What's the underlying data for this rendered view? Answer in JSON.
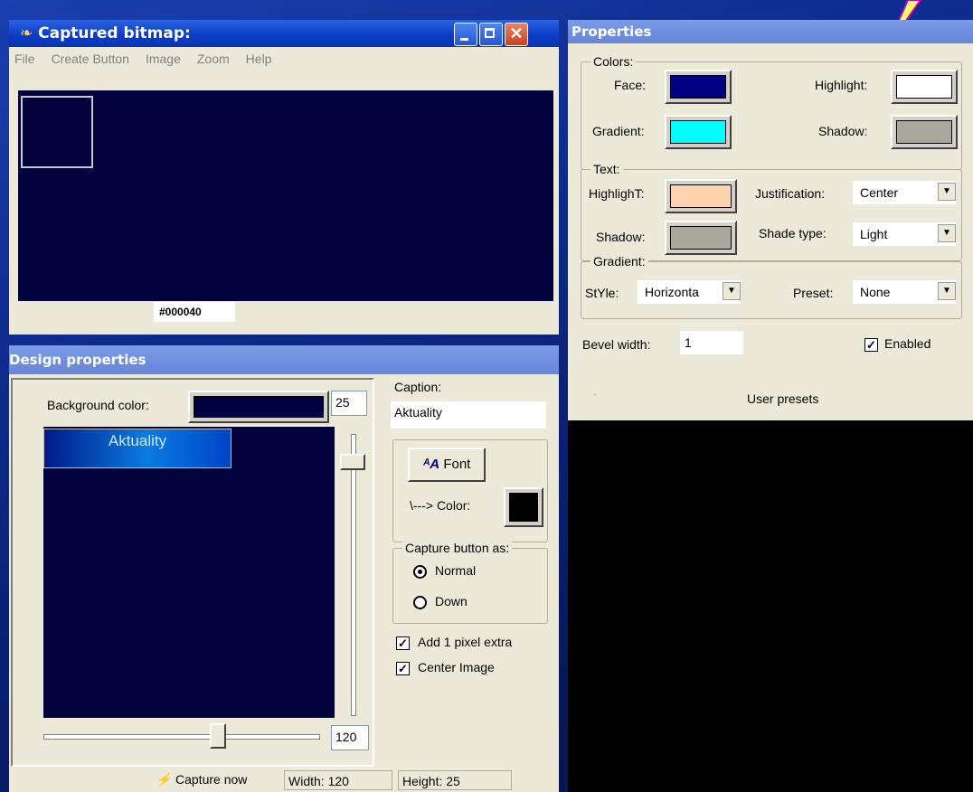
{
  "captured_window": {
    "title": "Captured bitmap:",
    "menu": [
      "File",
      "Create Button",
      "Image",
      "Zoom",
      "Help"
    ],
    "color_value": "#000040"
  },
  "properties_panel": {
    "title": "Properties",
    "colors": {
      "legend": "Colors:",
      "face_label": "Face:",
      "highlight_label": "Highlight:",
      "gradient_label": "Gradient:",
      "shadow_label": "Shadow:",
      "face_color": "#000080",
      "highlight_color": "#ffffff",
      "gradient_color": "#00ffff",
      "shadow_color": "#a8a89c"
    },
    "text": {
      "legend": "Text:",
      "highlight_label": "HighlighT:",
      "shadow_label": "Shadow:",
      "justification_label": "Justification:",
      "justification_value": "Center",
      "shade_type_label": "Shade type:",
      "shade_type_value": "Light",
      "highlight_color": "#ffd2b0",
      "shadow_color": "#a8a89c"
    },
    "gradient": {
      "legend": "Gradient:",
      "style_label": "StYle:",
      "style_value": "Horizonta",
      "preset_label": "Preset:",
      "preset_value": "None"
    },
    "bevel_label": "Bevel width:",
    "bevel_value": "1",
    "enabled_label": "Enabled",
    "enabled_checked": true,
    "user_presets": "User presets"
  },
  "design_window": {
    "title": "Design properties",
    "background_label": "Background color:",
    "background_color": "#000040",
    "height_value": "25",
    "width_value": "120",
    "preview_caption": "Aktuality",
    "caption_label": "Caption:",
    "caption_value": "Aktuality",
    "font_button": "Font",
    "color_label": "\\---> Color:",
    "capture_as": {
      "legend": "Capture button as:",
      "normal": "Normal",
      "down": "Down",
      "selected": "Normal"
    },
    "add_pixel_label": "Add 1 pixel extra",
    "center_image_label": "Center Image",
    "capture_now": "Capture now",
    "status_width": "Width: 120",
    "status_height": "Height: 25"
  }
}
